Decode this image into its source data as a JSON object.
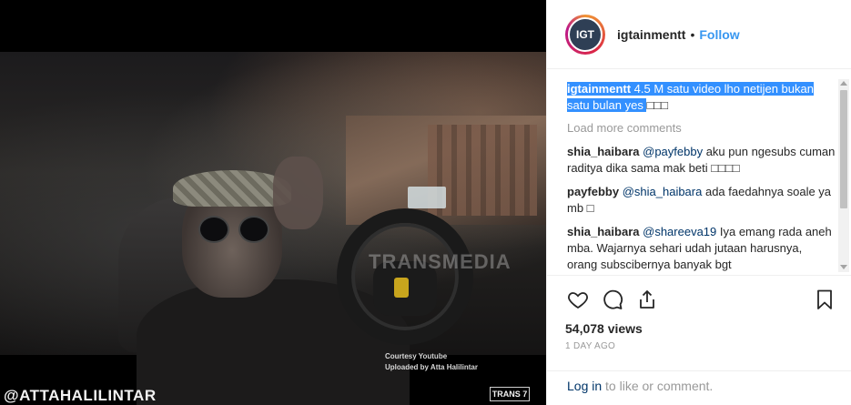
{
  "media": {
    "watermark": "TRANSMEDIA",
    "courtesy_line1": "Courtesy Youtube",
    "courtesy_line2": "Uploaded by Atta Halilintar",
    "handle_overlay": "@ATTAHALILINTAR",
    "channel_logo": "TRANS 7"
  },
  "header": {
    "avatar_text": "IGT",
    "username": "igtainmentt",
    "dot": "•",
    "follow": "Follow"
  },
  "caption": {
    "username": "igtainmentt",
    "text": " 4.5 M satu video lho netijen bukan satu bulan yes ",
    "emoji": "□□□"
  },
  "load_more": "Load more comments",
  "comments": [
    {
      "user": "shia_haibara",
      "mention": "@payfebby",
      "text": " aku pun ngesubs cuman raditya dika sama mak beti □□□□"
    },
    {
      "user": "payfebby",
      "mention": "@shia_haibara",
      "text": " ada faedahnya soale ya mb □"
    },
    {
      "user": "shia_haibara",
      "mention": "@shareeva19",
      "text": " Iya emang rada aneh mba. Wajarnya sehari udah jutaan harusnya, orang subscibernya banyak bgt"
    }
  ],
  "icons": {
    "like": "heart-icon",
    "comment": "comment-icon",
    "share": "share-icon",
    "save": "bookmark-icon"
  },
  "stats": {
    "views": "54,078 views",
    "time_ago": "1 DAY AGO"
  },
  "footer": {
    "login": "Log in",
    "rest": " to like or comment."
  },
  "colors": {
    "link": "#3897f0",
    "mention": "#003569",
    "highlight": "#3390ff"
  }
}
